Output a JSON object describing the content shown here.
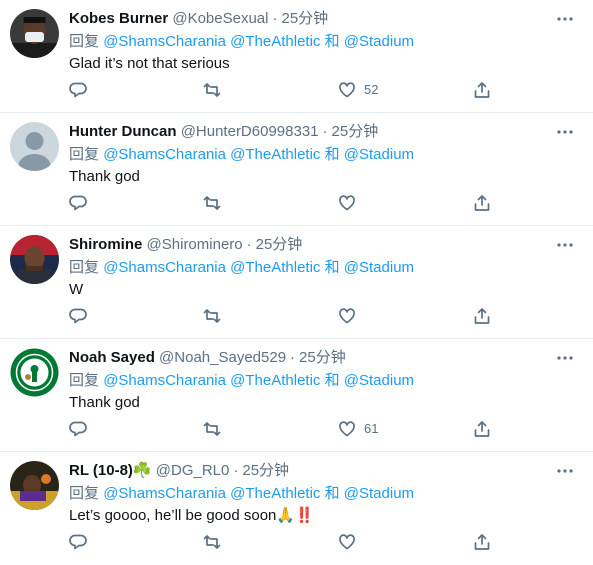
{
  "reply_prefix": "回复",
  "conjunction": "和",
  "dot": "·",
  "tweets": [
    {
      "display_name": "Kobes Burner",
      "handle": "@KobeSexual",
      "time": "25分钟",
      "mentions": [
        "@ShamsCharania",
        "@TheAthletic",
        "@Stadium"
      ],
      "text": "Glad it’s not that serious",
      "like_count": "52",
      "avatar": "masked-person-avatar"
    },
    {
      "display_name": "Hunter Duncan",
      "handle": "@HunterD60998331",
      "time": "25分钟",
      "mentions": [
        "@ShamsCharania",
        "@TheAthletic",
        "@Stadium"
      ],
      "text": "Thank god",
      "like_count": "",
      "avatar": "default-profile-avatar"
    },
    {
      "display_name": "Shiromine",
      "handle": "@Shirominero",
      "time": "25分钟",
      "mentions": [
        "@ShamsCharania",
        "@TheAthletic",
        "@Stadium"
      ],
      "text": "W",
      "like_count": "",
      "avatar": "broadcaster-avatar"
    },
    {
      "display_name": "Noah Sayed",
      "handle": "@Noah_Sayed529",
      "time": "25分钟",
      "mentions": [
        "@ShamsCharania",
        "@TheAthletic",
        "@Stadium"
      ],
      "text": "Thank god",
      "like_count": "61",
      "avatar": "celtics-logo-avatar"
    },
    {
      "display_name": "RL (10-8)",
      "name_emoji": "☘️",
      "handle": "@DG_RL0",
      "time": "25分钟",
      "mentions": [
        "@ShamsCharania",
        "@TheAthletic",
        "@Stadium"
      ],
      "text": "Let’s goooo, he’ll be good soon🙏‼️",
      "like_count": "",
      "avatar": "player-avatar"
    }
  ],
  "colors": {
    "link": "#1d9bf0",
    "secondary_text": "#5b7083",
    "divider": "#e6ecf0"
  }
}
